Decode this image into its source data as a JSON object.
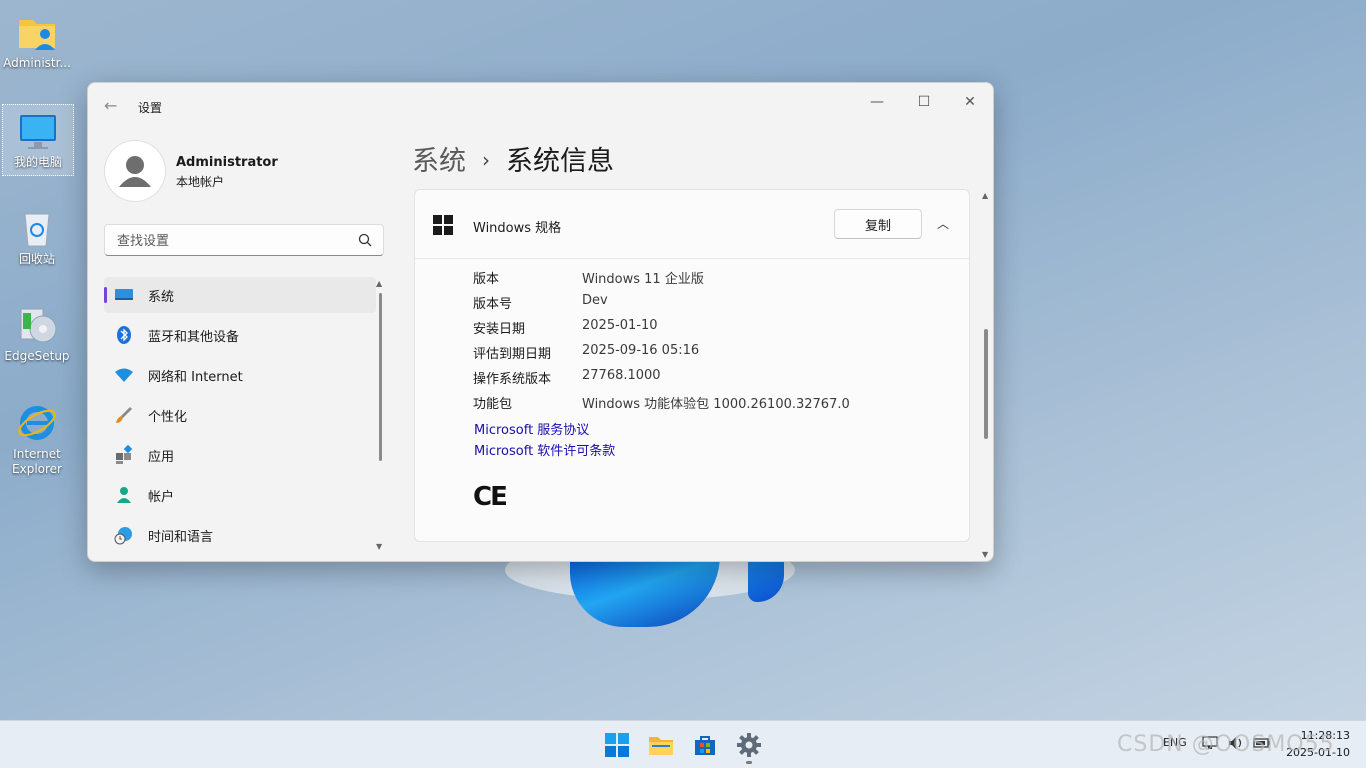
{
  "desktop": {
    "icons": [
      {
        "label": "Administr..."
      },
      {
        "label": "我的电脑"
      },
      {
        "label": "回收站"
      },
      {
        "label": "EdgeSetup"
      },
      {
        "label": "Internet\nExplorer"
      }
    ]
  },
  "window": {
    "title": "设置",
    "controls": {
      "minimize": "—",
      "maximize": "☐",
      "close": "✕"
    },
    "back": "←"
  },
  "user": {
    "name": "Administrator",
    "type": "本地帐户"
  },
  "search": {
    "placeholder": "查找设置"
  },
  "nav": {
    "items": [
      {
        "label": "系统",
        "icon": "display-icon",
        "active": true
      },
      {
        "label": "蓝牙和其他设备",
        "icon": "bluetooth-icon"
      },
      {
        "label": "网络和 Internet",
        "icon": "wifi-icon"
      },
      {
        "label": "个性化",
        "icon": "brush-icon"
      },
      {
        "label": "应用",
        "icon": "apps-icon"
      },
      {
        "label": "帐户",
        "icon": "person-icon"
      },
      {
        "label": "时间和语言",
        "icon": "globe-clock-icon"
      }
    ]
  },
  "breadcrumb": {
    "parent": "系统",
    "separator": "›",
    "current": "系统信息"
  },
  "spec_card": {
    "title": "Windows 规格",
    "copy_label": "复制",
    "collapse": "︿",
    "rows": [
      {
        "key": "版本",
        "value": "Windows 11 企业版"
      },
      {
        "key": "版本号",
        "value": "Dev"
      },
      {
        "key": "安装日期",
        "value": "2025-01-10"
      },
      {
        "key": "评估到期日期",
        "value": "2025-09-16 05:16"
      },
      {
        "key": "操作系统版本",
        "value": "27768.1000"
      },
      {
        "key": "功能包",
        "value": "Windows 功能体验包 1000.26100.32767.0"
      }
    ],
    "links": [
      "Microsoft 服务协议",
      "Microsoft 软件许可条款"
    ],
    "ce_mark": "CE"
  },
  "taskbar": {
    "tray": {
      "lang": "ENG"
    },
    "clock": {
      "time": "11:28:13",
      "date": "2025-01-10"
    }
  },
  "watermark": "CSDN @OOSMO55",
  "colors": {
    "accent": "#7a3fe0",
    "link": "#1a0dab",
    "taskbar": "#e6edf4"
  }
}
